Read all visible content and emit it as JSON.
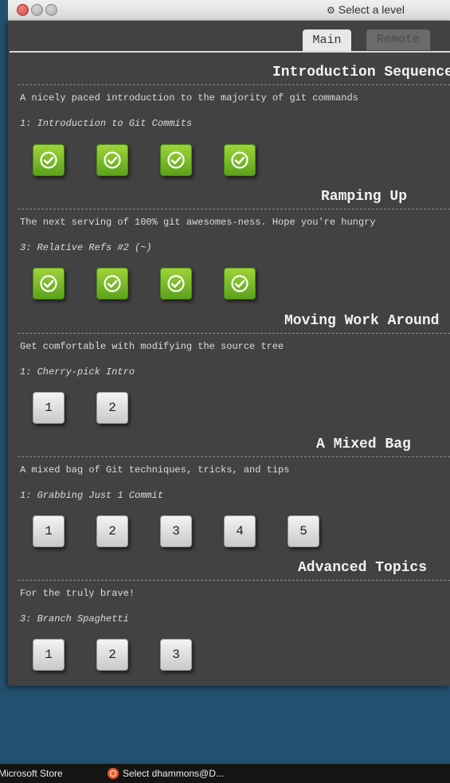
{
  "window": {
    "title": "Select a level",
    "title_icon": "gear-icon"
  },
  "tabs": {
    "main": "Main",
    "remote": "Remote"
  },
  "sections": [
    {
      "title": "Introduction Sequence",
      "description": "A nicely paced introduction to the majority of git commands",
      "current": "1: Introduction to Git Commits",
      "levels": [
        "done",
        "done",
        "done",
        "done"
      ]
    },
    {
      "title": "Ramping Up",
      "description": "The next serving of 100% git awesomes-ness. Hope you're hungry",
      "current": "3: Relative Refs #2 (~)",
      "levels": [
        "done",
        "done",
        "done",
        "done"
      ]
    },
    {
      "title": "Moving Work Around",
      "description": "Get comfortable with modifying the source tree",
      "current": "1: Cherry-pick Intro",
      "levels": [
        "1",
        "2"
      ]
    },
    {
      "title": "A Mixed Bag",
      "description": "A mixed bag of Git techniques, tricks, and tips",
      "current": "1: Grabbing Just 1 Commit",
      "levels": [
        "1",
        "2",
        "3",
        "4",
        "5"
      ]
    },
    {
      "title": "Advanced Topics",
      "description": "For the truly brave!",
      "current": "3: Branch Spaghetti",
      "levels": [
        "1",
        "2",
        "3"
      ]
    }
  ],
  "taskbar": {
    "item1": "Microsoft Store",
    "item2": "Select dhammons@D..."
  }
}
